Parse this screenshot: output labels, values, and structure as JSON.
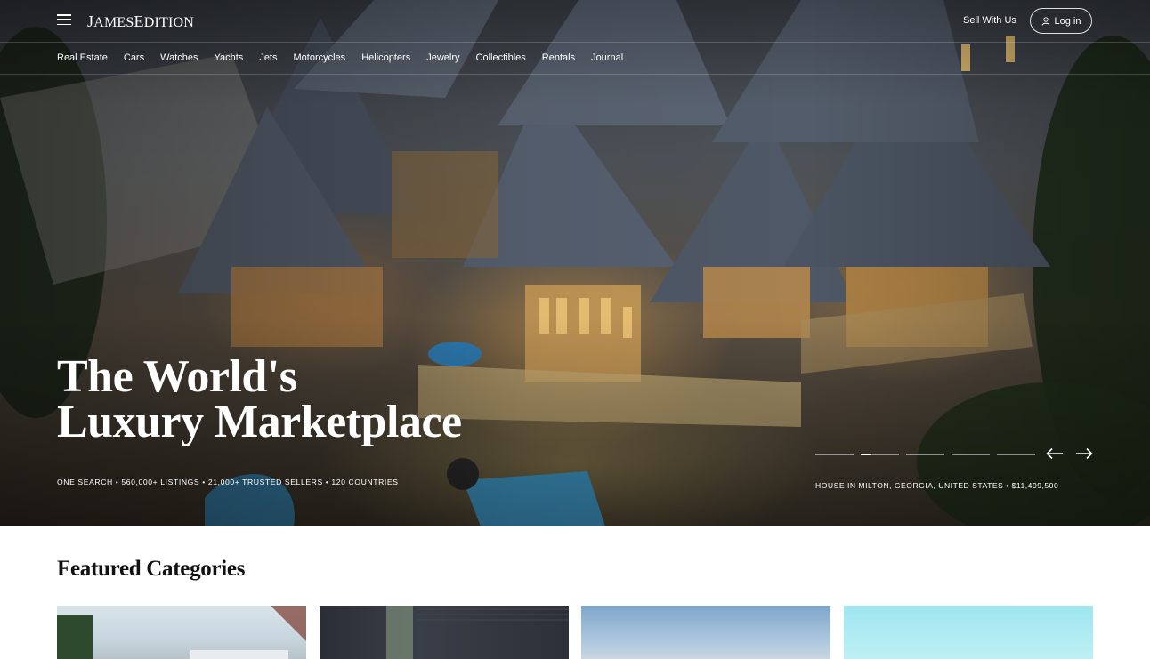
{
  "brand": {
    "logo_text": "JamesEdition"
  },
  "header": {
    "sell_label": "Sell With Us",
    "login_label": "Log in"
  },
  "categories_nav": [
    "Real Estate",
    "Cars",
    "Watches",
    "Yachts",
    "Jets",
    "Motorcycles",
    "Helicopters",
    "Jewelry",
    "Collectibles",
    "Rentals",
    "Journal"
  ],
  "hero": {
    "headline_line1": "The World's",
    "headline_line2": "Luxury Marketplace",
    "stats": "ONE SEARCH • 560,000+ LISTINGS • 21,000+ TRUSTED SELLERS • 120 COUNTRIES",
    "caption": "HOUSE IN MILTON, GEORGIA, UNITED STATES • $11,499,500",
    "slides_total": 5,
    "active_slide": 2
  },
  "featured": {
    "title": "Featured Categories"
  },
  "icons": {
    "menu": "menu-icon",
    "user": "user-icon",
    "prev": "arrow-left-icon",
    "next": "arrow-right-icon"
  }
}
